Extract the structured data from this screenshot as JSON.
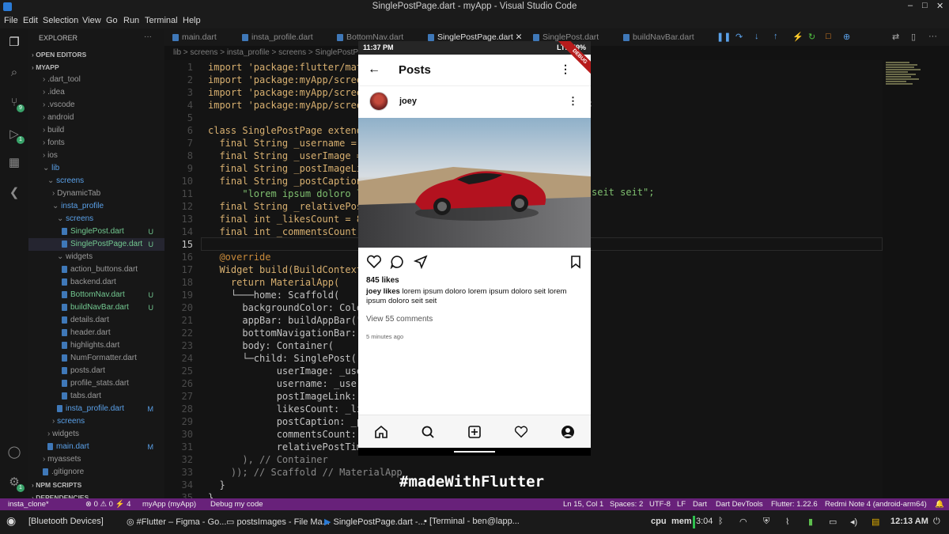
{
  "window": {
    "title": "SinglePostPage.dart - myApp - Visual Studio Code"
  },
  "menu": [
    "File",
    "Edit",
    "Selection",
    "View",
    "Go",
    "Run",
    "Terminal",
    "Help"
  ],
  "sidebar": {
    "header": "EXPLORER",
    "items": [
      {
        "label": "OPEN EDITORS",
        "indent": 0,
        "type": "section"
      },
      {
        "label": "MYAPP",
        "indent": 0,
        "type": "section"
      },
      {
        "label": ".dart_tool",
        "indent": 1,
        "type": "folder"
      },
      {
        "label": ".idea",
        "indent": 1,
        "type": "folder"
      },
      {
        "label": ".vscode",
        "indent": 1,
        "type": "folder"
      },
      {
        "label": "android",
        "indent": 1,
        "type": "folder"
      },
      {
        "label": "build",
        "indent": 1,
        "type": "folder"
      },
      {
        "label": "fonts",
        "indent": 1,
        "type": "folder"
      },
      {
        "label": "ios",
        "indent": 1,
        "type": "folder"
      },
      {
        "label": "lib",
        "indent": 1,
        "type": "folder",
        "open": true
      },
      {
        "label": "screens",
        "indent": 2,
        "type": "folder",
        "open": true
      },
      {
        "label": "DynamicTab",
        "indent": 3,
        "type": "folder"
      },
      {
        "label": "insta_profile",
        "indent": 3,
        "type": "folder",
        "open": true
      },
      {
        "label": "screens",
        "indent": 4,
        "type": "folder",
        "open": true
      },
      {
        "label": "SinglePost.dart",
        "indent": 5,
        "type": "file",
        "status": "U"
      },
      {
        "label": "SinglePostPage.dart",
        "indent": 5,
        "type": "file",
        "status": "U",
        "active": true
      },
      {
        "label": "widgets",
        "indent": 4,
        "type": "folder",
        "open": true
      },
      {
        "label": "action_buttons.dart",
        "indent": 5,
        "type": "file"
      },
      {
        "label": "backend.dart",
        "indent": 5,
        "type": "file"
      },
      {
        "label": "BottomNav.dart",
        "indent": 5,
        "type": "file",
        "status": "U"
      },
      {
        "label": "buildNavBar.dart",
        "indent": 5,
        "type": "file",
        "status": "U"
      },
      {
        "label": "details.dart",
        "indent": 5,
        "type": "file"
      },
      {
        "label": "header.dart",
        "indent": 5,
        "type": "file"
      },
      {
        "label": "highlights.dart",
        "indent": 5,
        "type": "file"
      },
      {
        "label": "NumFormatter.dart",
        "indent": 5,
        "type": "file"
      },
      {
        "label": "posts.dart",
        "indent": 5,
        "type": "file"
      },
      {
        "label": "profile_stats.dart",
        "indent": 5,
        "type": "file"
      },
      {
        "label": "tabs.dart",
        "indent": 5,
        "type": "file"
      },
      {
        "label": "insta_profile.dart",
        "indent": 4,
        "type": "file",
        "status": "M"
      },
      {
        "label": "screens",
        "indent": 3,
        "type": "folder"
      },
      {
        "label": "widgets",
        "indent": 2,
        "type": "folder"
      },
      {
        "label": "main.dart",
        "indent": 2,
        "type": "file",
        "status": "M"
      },
      {
        "label": "myassets",
        "indent": 1,
        "type": "folder"
      },
      {
        "label": ".gitignore",
        "indent": 1,
        "type": "file"
      },
      {
        "label": "NPM SCRIPTS",
        "indent": 0,
        "type": "section"
      },
      {
        "label": "DEPENDENCIES",
        "indent": 0,
        "type": "section"
      }
    ]
  },
  "tabs": [
    "main.dart",
    "insta_profile.dart",
    "BottomNav.dart",
    "SinglePostPage.dart",
    "SinglePost.dart",
    "buildNavBar.dart"
  ],
  "breadcrumb": "lib > screens > insta_profile > screens > SinglePostPa",
  "editor": {
    "lines": [
      {
        "n": "1",
        "t": "import 'package:flutter/mat"
      },
      {
        "n": "2",
        "t": "import 'package:myApp/scree"
      },
      {
        "n": "3",
        "t": "import 'package:myApp/scree"
      },
      {
        "n": "4",
        "t": "import 'package:myApp/scree"
      },
      {
        "n": "5",
        "t": ""
      },
      {
        "n": "6",
        "t": "class SinglePostPage extend"
      },
      {
        "n": "7",
        "t": "  final String _username ="
      },
      {
        "n": "8",
        "t": "  final String _userImage ="
      },
      {
        "n": "9",
        "t": "  final String _postImageLi"
      },
      {
        "n": "10",
        "t": "  final String _postCaption"
      },
      {
        "n": "11",
        "t": "      \"lorem ipsum doloro l"
      },
      {
        "n": "12",
        "t": "  final String _relativePos"
      },
      {
        "n": "13",
        "t": "  final int _likesCount = 8"
      },
      {
        "n": "14",
        "t": "  final int _commentsCount"
      },
      {
        "n": "15",
        "t": ""
      },
      {
        "n": "16",
        "t": "  @override"
      },
      {
        "n": "17",
        "t": "  Widget build(BuildContext"
      },
      {
        "n": "18",
        "t": "    return MaterialApp("
      },
      {
        "n": "19",
        "t": "    └───home: Scaffold("
      },
      {
        "n": "20",
        "t": "      backgroundColor: Colo"
      },
      {
        "n": "21",
        "t": "      appBar: buildAppBar(\""
      },
      {
        "n": "22",
        "t": "      bottomNavigationBar:"
      },
      {
        "n": "23",
        "t": "      body: Container("
      },
      {
        "n": "24",
        "t": "      └─child: SinglePost("
      },
      {
        "n": "25",
        "t": "            userImage: _use"
      },
      {
        "n": "26",
        "t": "            username: _user"
      },
      {
        "n": "27",
        "t": "            postImageLink:"
      },
      {
        "n": "28",
        "t": "            likesCount: _li"
      },
      {
        "n": "29",
        "t": "            postCaption: _p"
      },
      {
        "n": "30",
        "t": "            commentsCount:"
      },
      {
        "n": "31",
        "t": "            relativePostTim"
      },
      {
        "n": "32",
        "t": "      ), // Container"
      },
      {
        "n": "33",
        "t": "    )); // Scaffold // MaterialApp"
      },
      {
        "n": "34",
        "t": "  }"
      },
      {
        "n": "35",
        "t": "}"
      }
    ],
    "right_fragments": {
      "line4": ";",
      "line11": "seit seit\";"
    }
  },
  "phone": {
    "status_time": "11:37 PM",
    "status_right": "LTE  59%",
    "debug_label": "DEBUG",
    "appbar_title": "Posts",
    "username": "joey",
    "likes": "845 likes",
    "caption_user": "joey likes",
    "caption_text": "lorem ipsum doloro lorem ipsum doloro seit lorem ipsum doloro seit seit",
    "view_comments": "View 55 comments",
    "time_ago": "5 minutes ago"
  },
  "overlay_text": "#madeWithFlutter",
  "statusbar": {
    "left": [
      "insta_clone*",
      "⊗ 0 ⚠ 0 ⚡ 4",
      "myApp (myApp)",
      "Debug my code"
    ],
    "right": [
      "Ln 15, Col 1",
      "Spaces: 2",
      "UTF-8",
      "LF",
      "Dart",
      "Dart DevTools",
      "Flutter: 1.22.6",
      "Redmi Note 4 (android-arm64)"
    ]
  },
  "taskbar": {
    "items": [
      "[Bluetooth Devices]",
      "#Flutter – Figma - Go...",
      "postsImages - File Ma...",
      "SinglePostPage.dart -...",
      "[Terminal - ben@lapp..."
    ],
    "cpu": "cpu",
    "mem": "mem",
    "clock_small": "3:04",
    "clock": "12:13 AM"
  },
  "colors": {
    "accent": "#68217a",
    "activity_badge": "#39a36a",
    "keyword": "#e0a43f",
    "ribbon": "#b71c1c"
  }
}
